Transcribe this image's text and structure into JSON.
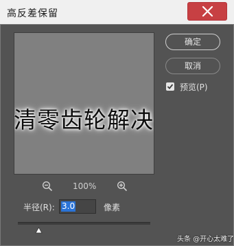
{
  "window": {
    "title": "高反差保留"
  },
  "preview": {
    "text": "清零齿轮解决"
  },
  "buttons": {
    "ok_label": "确定",
    "cancel_label": "取消"
  },
  "preview_toggle": {
    "label": "预览(P)",
    "checked": true
  },
  "zoom": {
    "level": "100%"
  },
  "radius": {
    "label": "半径(R):",
    "value": "3.0",
    "unit": "像素"
  },
  "watermark": {
    "text": "头条 @开心太难了"
  },
  "colors": {
    "dialog_bg": "#535353",
    "close_button": "#c74043",
    "selection": "#2a73d6"
  },
  "icons": {
    "close": "close-icon",
    "zoom_out": "zoom-out-icon",
    "zoom_in": "zoom-in-icon",
    "checkbox": "checkmark-icon",
    "slider": "slider-thumb-icon"
  }
}
